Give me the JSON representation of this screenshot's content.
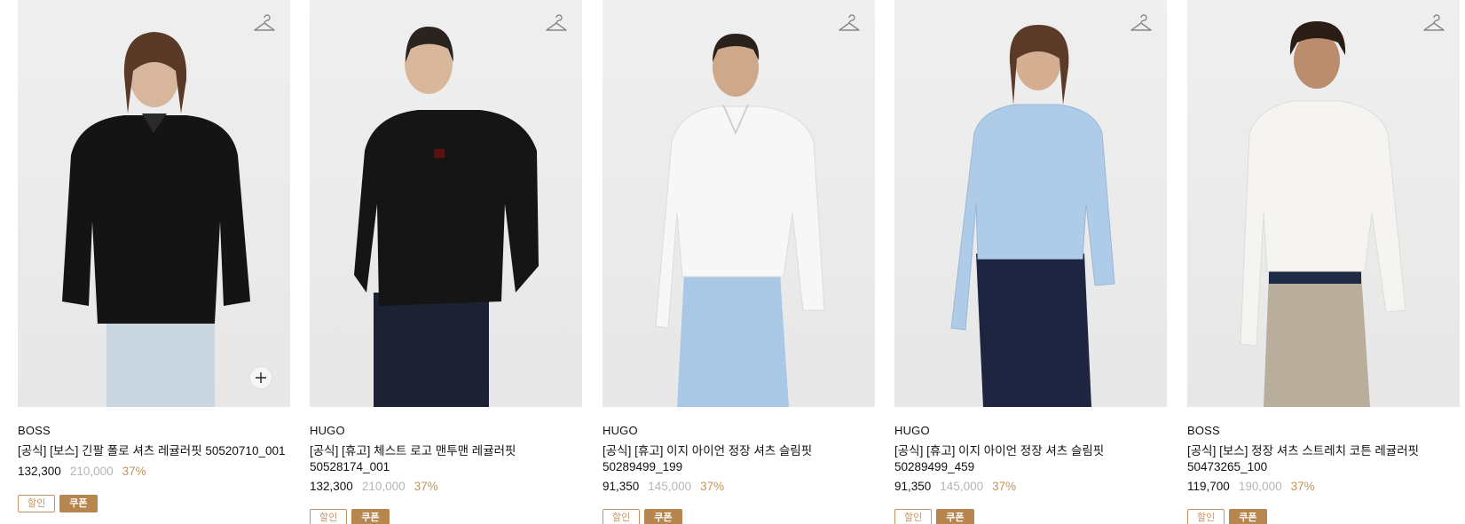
{
  "products": [
    {
      "brand": "BOSS",
      "title": "[공식] [보스] 긴팔 폴로 셔츠 레귤러핏 50520710_001",
      "price": "132,300",
      "original_price": "210,000",
      "discount": "37%",
      "badges": {
        "sale": "할인",
        "coupon": "쿠폰"
      },
      "has_quick_add": true,
      "top_color": "#141414",
      "bottom_color": "#c9d6df"
    },
    {
      "brand": "HUGO",
      "title": "[공식] [휴고] 체스트 로고 맨투맨 레귤러핏 50528174_001",
      "price": "132,300",
      "original_price": "210,000",
      "discount": "37%",
      "badges": {
        "sale": "할인",
        "coupon": "쿠폰"
      },
      "has_quick_add": false,
      "top_color": "#151515",
      "bottom_color": "#1c2233"
    },
    {
      "brand": "HUGO",
      "title": "[공식] [휴고] 이지 아이언 정장 셔츠 슬림핏 50289499_199",
      "price": "91,350",
      "original_price": "145,000",
      "discount": "37%",
      "badges": {
        "sale": "할인",
        "coupon": "쿠폰"
      },
      "has_quick_add": false,
      "top_color": "#f7f7f7",
      "bottom_color": "#a9c8e6"
    },
    {
      "brand": "HUGO",
      "title": "[공식] [휴고] 이지 아이언 정장 셔츠 슬림핏 50289499_459",
      "price": "91,350",
      "original_price": "145,000",
      "discount": "37%",
      "badges": {
        "sale": "할인",
        "coupon": "쿠폰"
      },
      "has_quick_add": false,
      "top_color": "#aecbe8",
      "bottom_color": "#1d2540"
    },
    {
      "brand": "BOSS",
      "title": "[공식] [보스] 정장 셔츠 스트레치 코튼 레귤러핏 50473265_100",
      "price": "119,700",
      "original_price": "190,000",
      "discount": "37%",
      "badges": {
        "sale": "할인",
        "coupon": "쿠폰"
      },
      "has_quick_add": false,
      "top_color": "#f5f4f1",
      "bottom_color": "#b9ad9c"
    }
  ],
  "icons": {
    "wishlist": "hanger-icon",
    "quick_add": "plus-icon"
  },
  "colors": {
    "discount": "#c4935a",
    "coupon_badge": "#b7864f",
    "original_price": "#b5b5b5"
  }
}
